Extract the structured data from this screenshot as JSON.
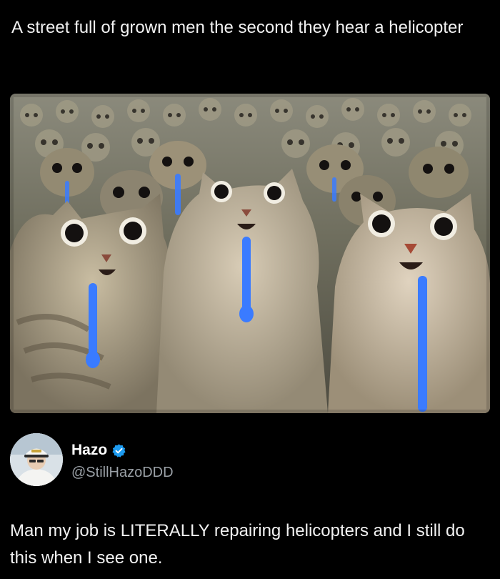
{
  "post": {
    "caption": "A street full of grown men the second they hear a helicopter",
    "image_subject": "cats-crowd-drooling-image"
  },
  "tweet": {
    "display_name": "Hazo",
    "handle": "@StillHazoDDD",
    "verified": true,
    "text": "Man my job is LITERALLY repairing helicopters and I still do this when I see one."
  },
  "colors": {
    "background": "#000000",
    "text": "#f2f2f2",
    "handle": "#9aa0a6",
    "verified": "#1d9bf0",
    "drool": "#3a7bff"
  }
}
